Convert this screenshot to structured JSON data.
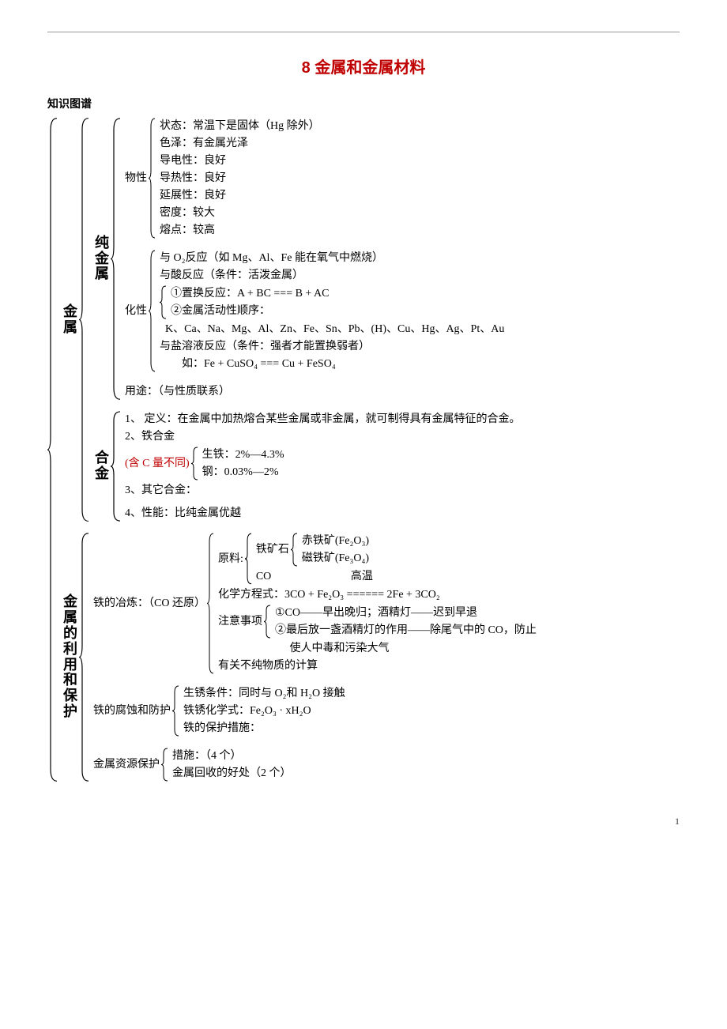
{
  "title": "8 金属和金属材料",
  "section_label": "知识图谱",
  "root_labels": {
    "metal": "金属",
    "util": "金属的利用和保护"
  },
  "pure_metal": {
    "label": "纯金属",
    "phys_label": "物性",
    "phys": [
      "状态：常温下是固体（Hg 除外）",
      "色泽：有金属光泽",
      "导电性：良好",
      "导热性：良好",
      "延展性：良好",
      "密度：较大",
      "熔点：较高"
    ],
    "chem_label": "化性",
    "chem_o2": "与 O₂反应（如 Mg、Al、Fe 能在氧气中燃烧）",
    "chem_acid": "与酸反应（条件：活泼金属）",
    "chem_disp": "①置换反应：A + BC === B + AC",
    "chem_act": "②金属活动性顺序：",
    "chem_act_list": "  K、Ca、Na、Mg、Al、Zn、Fe、Sn、Pb、(H)、Cu、Hg、Ag、Pt、Au",
    "chem_salt": "与盐溶液反应（条件：强者才能置换弱者）",
    "chem_salt_eg": "        如：Fe + CuSO₄ === Cu + FeSO₄",
    "use": "用途：（与性质联系）"
  },
  "alloy": {
    "label": "合金",
    "def": "1、 定义：在金属中加热熔合某些金属或非金属，就可制得具有金属特征的合金。",
    "iron_label": "2、铁合金",
    "c_note": "(含 C 量不同)",
    "pig_iron": "生铁：2%—4.3%",
    "steel": "钢：0.03%—2%",
    "other": "3、其它合金：",
    "perf": "4、性能：比纯金属优越"
  },
  "smelt": {
    "label": "铁的冶炼：（CO 还原）",
    "raw_label": "原料:",
    "ore_label": "铁矿石",
    "ore1": "赤铁矿(Fe₂O₃)",
    "ore2": "磁铁矿(Fe₃O₄)",
    "co": "CO",
    "cond": "高温",
    "eq": "化学方程式：3CO + Fe₂O₃ ====== 2Fe + 3CO₂",
    "note_label": "注意事项",
    "note1": "①CO——早出晚归；酒精灯——迟到早退",
    "note2": "②最后放一盏酒精灯的作用——除尾气中的 CO，防止",
    "note2b": "   使人中毒和污染大气",
    "calc": "有关不纯物质的计算"
  },
  "corrosion": {
    "label": "铁的腐蚀和防护",
    "cond": "生锈条件：同时与 O₂和 H₂O 接触",
    "formula": "铁锈化学式：Fe₂O₃ · xH₂O",
    "protect": "铁的保护措施："
  },
  "resource": {
    "label": "金属资源保护",
    "measure": "措施：（4 个）",
    "recycle": "金属回收的好处（2 个）"
  },
  "page_num": "1"
}
